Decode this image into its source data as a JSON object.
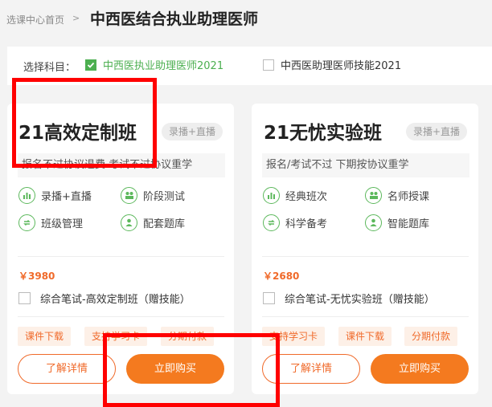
{
  "header": {
    "breadcrumb": "选课中心首页",
    "separator": ">",
    "title": "中西医结合执业助理医师"
  },
  "subject_bar": {
    "label": "选择科目：",
    "options": [
      {
        "label": "中西医执业助理医师2021",
        "checked": true
      },
      {
        "label": "中西医助理医师技能2021",
        "checked": false
      }
    ]
  },
  "cards": [
    {
      "title": "21高效定制班",
      "mode_tag": "录播+直播",
      "description": "报名不过协议退费 考试不过协议重学",
      "features": [
        {
          "label": "录播+直播",
          "icon": "chart-bars-icon"
        },
        {
          "label": "阶段测试",
          "icon": "users-icon"
        },
        {
          "label": "班级管理",
          "icon": "refresh-icon"
        },
        {
          "label": "配套题库",
          "icon": "user-icon"
        }
      ],
      "price": "￥3980",
      "combo_label": "综合笔试-高效定制班（赠技能）",
      "tags": [
        "课件下载",
        "支持学习卡",
        "分期付款"
      ],
      "detail_button": "了解详情",
      "buy_button": "立即购买"
    },
    {
      "title": "21无忧实验班",
      "mode_tag": "录播+直播",
      "description": "报名/考试不过 下期按协议重学",
      "features": [
        {
          "label": "经典班次",
          "icon": "chart-bars-icon"
        },
        {
          "label": "名师授课",
          "icon": "users-icon"
        },
        {
          "label": "科学备考",
          "icon": "refresh-icon"
        },
        {
          "label": "智能题库",
          "icon": "user-icon"
        }
      ],
      "price": "￥2680",
      "combo_label": "综合笔试-无忧实验班（赠技能）",
      "tags": [
        "支持学习卡",
        "课件下载",
        "分期付款"
      ],
      "detail_button": "了解详情",
      "buy_button": "立即购买"
    }
  ],
  "colors": {
    "accent_orange": "#f47a1f",
    "check_green": "#4caf50",
    "annotation_red": "#ff0000"
  }
}
